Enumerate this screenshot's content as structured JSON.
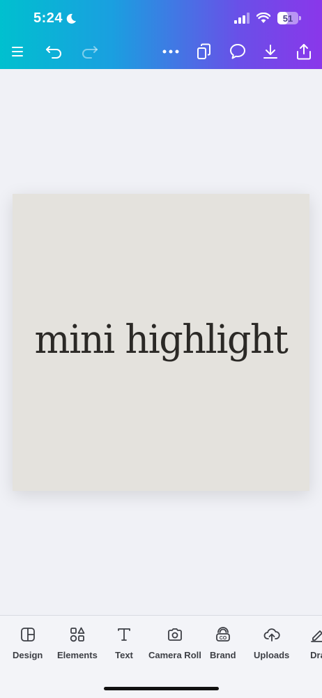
{
  "status_bar": {
    "time": "5:24",
    "battery_percent": "51",
    "battery_level": 0.51
  },
  "toolbar": {
    "menu": "menu-icon",
    "undo": "undo-icon",
    "redo": "redo-icon",
    "more": "more-icon",
    "pages": "pages-icon",
    "comment": "comment-icon",
    "download": "download-icon",
    "share": "share-icon"
  },
  "canvas": {
    "text": "mini highlight",
    "background": "#e4e2dd",
    "text_color": "#2b2926"
  },
  "bottom_tabs": [
    {
      "label": "Design",
      "icon": "layout-icon"
    },
    {
      "label": "Elements",
      "icon": "shapes-icon"
    },
    {
      "label": "Text",
      "icon": "text-icon"
    },
    {
      "label": "Camera Roll",
      "icon": "camera-icon"
    },
    {
      "label": "Brand",
      "icon": "brand-icon"
    },
    {
      "label": "Uploads",
      "icon": "upload-cloud-icon"
    },
    {
      "label": "Dra",
      "icon": "draw-icon"
    }
  ],
  "colors": {
    "gradient_start": "#00c0cf",
    "gradient_end": "#8a37ea"
  }
}
